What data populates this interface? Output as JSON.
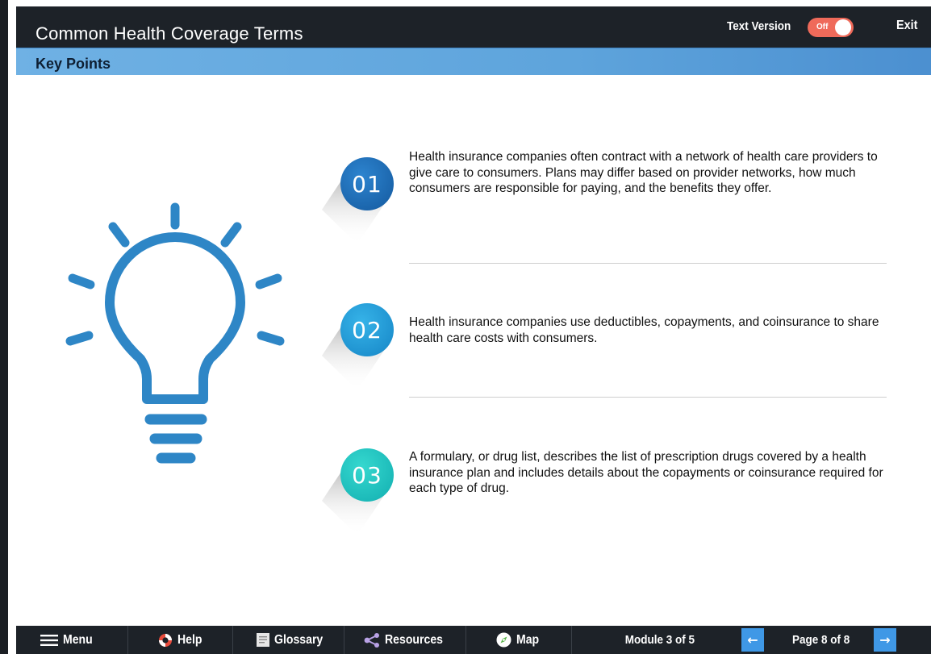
{
  "header": {
    "title": "Common Health Coverage Terms",
    "text_version_label": "Text Version",
    "toggle_state": "Off",
    "exit_label": "Exit"
  },
  "section": {
    "title": "Key Points"
  },
  "points": [
    {
      "number": "01",
      "text": "Health insurance companies often contract with a network of health care providers to give care to consumers. Plans may differ based on provider networks, how much consumers are responsible for paying, and the benefits they offer.",
      "color": "#1a6fb8"
    },
    {
      "number": "02",
      "text": "Health insurance companies use deductibles, copayments, and coinsurance to share health care costs with consumers.",
      "color": "#1d9fd8"
    },
    {
      "number": "03",
      "text": "A formulary, or drug list, describes the list of prescription drugs covered by a health insurance plan and includes details about the copayments or coinsurance required for each type of drug.",
      "color": "#1fc7c0"
    }
  ],
  "nav": {
    "menu": "Menu",
    "help": "Help",
    "glossary": "Glossary",
    "resources": "Resources",
    "map": "Map",
    "module": "Module 3 of 5",
    "page": "Page 8 of 8",
    "prev_arrow": "←",
    "next_arrow": "→"
  },
  "colors": {
    "bar_dark": "#1d2228",
    "section_blue": "#5ea4dc",
    "bulb_blue": "#2e86c6",
    "toggle_off": "#ef6a5a",
    "arrow_blue": "#3f98e6"
  }
}
